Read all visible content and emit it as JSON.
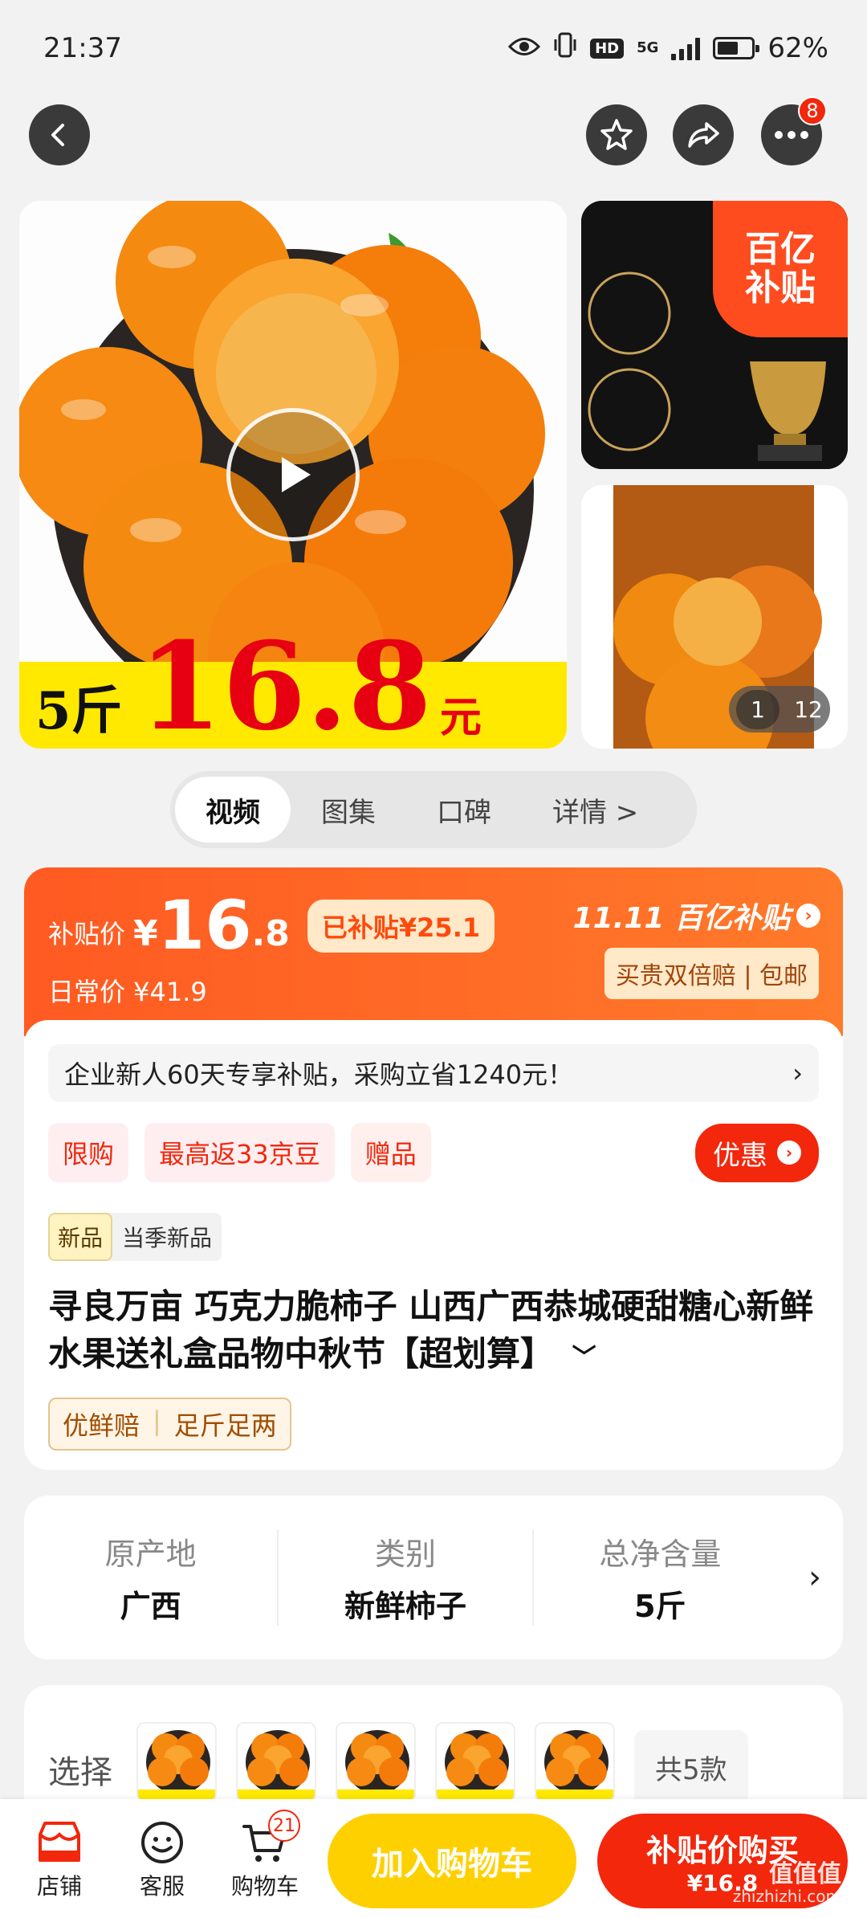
{
  "status_bar": {
    "time": "21:37",
    "network": "5G",
    "hd": "HD",
    "battery_percent": "62%",
    "battery_level": 0.62
  },
  "topnav": {
    "more_badge": "8"
  },
  "gallery": {
    "overlay_weight": "5斤",
    "overlay_price": "16.8",
    "overlay_unit": "元",
    "subsidy_tag_line1": "百亿",
    "subsidy_tag_line2": "补贴",
    "counter_current": "1",
    "counter_total": "12"
  },
  "media_tabs": [
    {
      "label": "视频"
    },
    {
      "label": "图集"
    },
    {
      "label": "口碑"
    },
    {
      "label": "详情 >"
    }
  ],
  "price": {
    "subsidy_label": "补贴价",
    "currency": "¥",
    "integer": "16",
    "decimal": ".8",
    "saved_text": "已补贴¥25.1",
    "original_label": "日常价 ¥41.9",
    "event_label": "11.11 百亿补贴",
    "guarantee_text": "买贵双倍赔 | 包邮"
  },
  "promo": {
    "bar_text": "企业新人60天专享补贴，采购立省1240元！",
    "tags": [
      "限购",
      "最高返33京豆",
      "赠品"
    ],
    "discount_button": "优惠"
  },
  "product": {
    "new_badge": "新品",
    "new_badge_text": "当季新品",
    "title": "寻良万亩 巧克力脆柿子 山西广西恭城硬甜糖心新鲜水果送礼盒品物中秋节【超划算】",
    "assurance": [
      "优鲜赔",
      "足斤足两"
    ]
  },
  "specs": [
    {
      "label": "原产地",
      "value": "广西"
    },
    {
      "label": "类别",
      "value": "新鲜柿子"
    },
    {
      "label": "总净含量",
      "value": "5斤"
    }
  ],
  "variants": {
    "label": "选择",
    "total_text": "共5款"
  },
  "bottom_bar": {
    "shop": "店铺",
    "service": "客服",
    "cart": "购物车",
    "cart_badge": "21",
    "add_to_cart": "加入购物车",
    "buy_now": "补贴价购买",
    "buy_now_price": "¥16.8"
  },
  "watermark": {
    "line1": "值值值",
    "line2": "zhizhizhi.com"
  }
}
